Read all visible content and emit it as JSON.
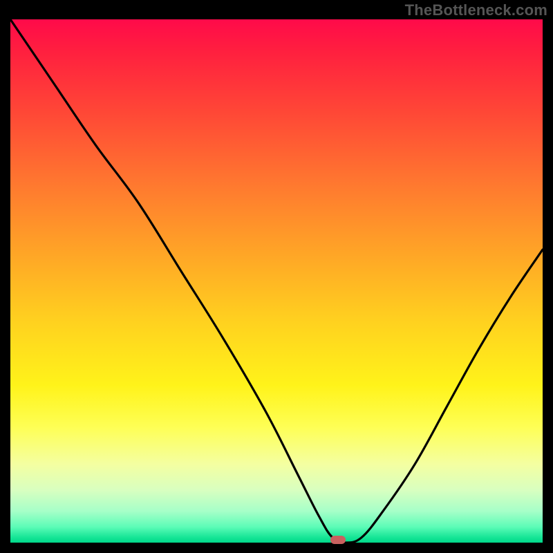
{
  "watermark": "TheBottleneck.com",
  "chart_data": {
    "type": "line",
    "title": "",
    "xlabel": "",
    "ylabel": "",
    "xlim": [
      0,
      100
    ],
    "ylim": [
      0,
      100
    ],
    "x": [
      0,
      8,
      16,
      24,
      32,
      40,
      48,
      54,
      58,
      60.5,
      63,
      66,
      70,
      76,
      82,
      88,
      94,
      100
    ],
    "y": [
      100,
      88,
      76,
      65,
      52,
      39,
      25,
      13,
      5,
      1,
      0,
      1,
      6,
      15,
      26,
      37,
      47,
      56
    ],
    "marker": {
      "x": 61.5,
      "y": 0.5
    },
    "gradient_stops": [
      {
        "pos": 0,
        "color": "#ff0a4a"
      },
      {
        "pos": 18,
        "color": "#ff4836"
      },
      {
        "pos": 45,
        "color": "#ffa626"
      },
      {
        "pos": 70,
        "color": "#fff31a"
      },
      {
        "pos": 90,
        "color": "#d8ffc0"
      },
      {
        "pos": 100,
        "color": "#00d88a"
      }
    ]
  }
}
